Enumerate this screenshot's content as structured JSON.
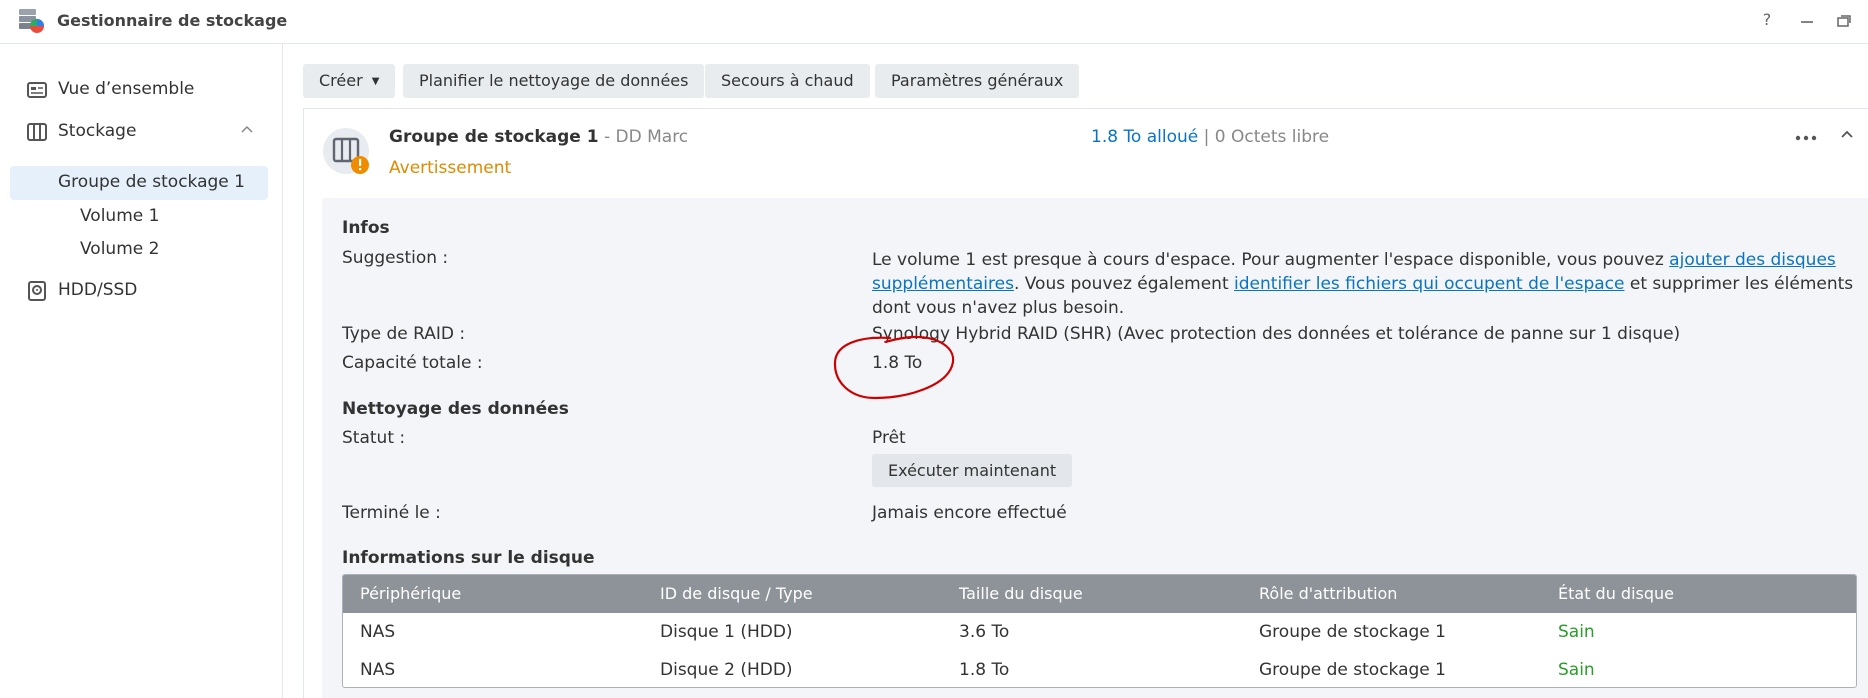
{
  "window": {
    "title": "Gestionnaire de stockage",
    "help_icon": "help-icon",
    "minimize_icon": "minimize-icon",
    "restore_icon": "restore-icon"
  },
  "sidebar": {
    "items": [
      {
        "label": "Vue d’ensemble",
        "icon": "overview-icon"
      },
      {
        "label": "Stockage",
        "icon": "storage-icon"
      },
      {
        "label": "Groupe de stockage 1"
      },
      {
        "label": "Volume 1"
      },
      {
        "label": "Volume 2"
      },
      {
        "label": "HDD/SSD",
        "icon": "hdd-icon"
      }
    ]
  },
  "toolbar": {
    "create": "Créer",
    "schedule": "Planifier le nettoyage de données",
    "hotspare": "Secours à chaud",
    "settings": "Paramètres généraux"
  },
  "pool": {
    "name": "Groupe de stockage 1",
    "owner": " - DD Marc",
    "status": "Avertissement",
    "allocated": "1.8 To alloué",
    "separator": " | ",
    "free": "0 Octets libre"
  },
  "infos": {
    "title": "Infos",
    "suggestion_label": "Suggestion :",
    "suggestion_part1": "Le volume 1 est presque à cours d'espace. Pour augmenter l'espace disponible, vous pouvez ",
    "suggestion_link1": "ajouter des disques supplémentaires",
    "suggestion_part2": ". Vous pouvez également ",
    "suggestion_link2": "identifier les fichiers qui occupent de l'espace",
    "suggestion_part3": " et supprimer les éléments dont vous n'avez plus besoin.",
    "raid_label": "Type de RAID :",
    "raid_value": "Synology Hybrid RAID (SHR) (Avec protection des données et tolérance de panne sur 1 disque)",
    "capacity_label": "Capacité totale :",
    "capacity_value": "1.8 To"
  },
  "scrubbing": {
    "title": "Nettoyage des données",
    "status_label": "Statut :",
    "status_value": "Prêt",
    "run_button": "Exécuter maintenant",
    "finished_label": "Terminé le :",
    "finished_value": "Jamais encore effectué"
  },
  "disks": {
    "title": "Informations sur le disque",
    "columns": [
      "Périphérique",
      "ID de disque / Type",
      "Taille du disque",
      "Rôle d'attribution",
      "État du disque"
    ],
    "rows": [
      [
        "NAS",
        "Disque 1 (HDD)",
        "3.6 To",
        "Groupe de stockage 1",
        "Sain"
      ],
      [
        "NAS",
        "Disque 2 (HDD)",
        "1.8 To",
        "Groupe de stockage 1",
        "Sain"
      ]
    ]
  },
  "colors": {
    "accent": "#0a74c4",
    "warning": "#e08a00",
    "healthy": "#2a9d2a",
    "annotation": "#cc0000"
  }
}
